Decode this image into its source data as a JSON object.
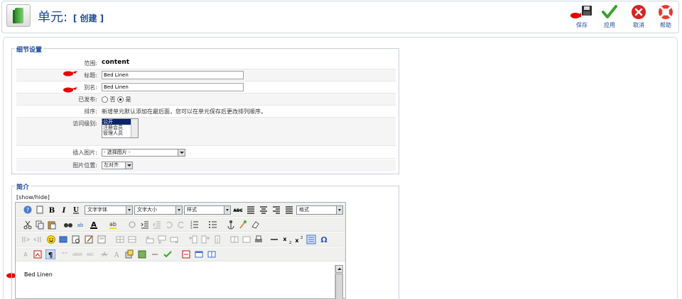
{
  "header": {
    "title": "单元:",
    "subtitle": "[ 创建 ]",
    "toolbar": {
      "save_label": "保存",
      "apply_label": "应用",
      "cancel_label": "取消",
      "help_label": "帮助"
    }
  },
  "details": {
    "legend": "细节设置",
    "section_label": "范围:",
    "section_value": "content",
    "title_label": "标题:",
    "title_value": "Bed Linen",
    "alias_label": "别名:",
    "alias_value": "Bed Linen",
    "published_label": "已发布:",
    "published_options": [
      "否",
      "是"
    ],
    "published_selected": "是",
    "order_label": "排序:",
    "order_text": "新增单元默认添加在最后面，您可以在单元保存后更改排列顺序。",
    "access_label": "访问级别:",
    "access_options": [
      "公开",
      "注册会员",
      "管理人员"
    ],
    "access_selected": "公开",
    "image_label": "插入图片:",
    "image_select": "- 选择图片 -",
    "image_pos_label": "图片位置:",
    "image_pos_select": "左对齐"
  },
  "intro": {
    "legend": "简介",
    "showhide": "[show/hide]",
    "font_family_select": "文字字体",
    "font_size_select": "文字大小",
    "style_select": "样式",
    "format_select": "格式",
    "content": "Bed Linen"
  },
  "colors": {
    "accent": "#1c4a9c",
    "marker": "#e60000",
    "toolbar_bg": "#f0f0ee"
  }
}
